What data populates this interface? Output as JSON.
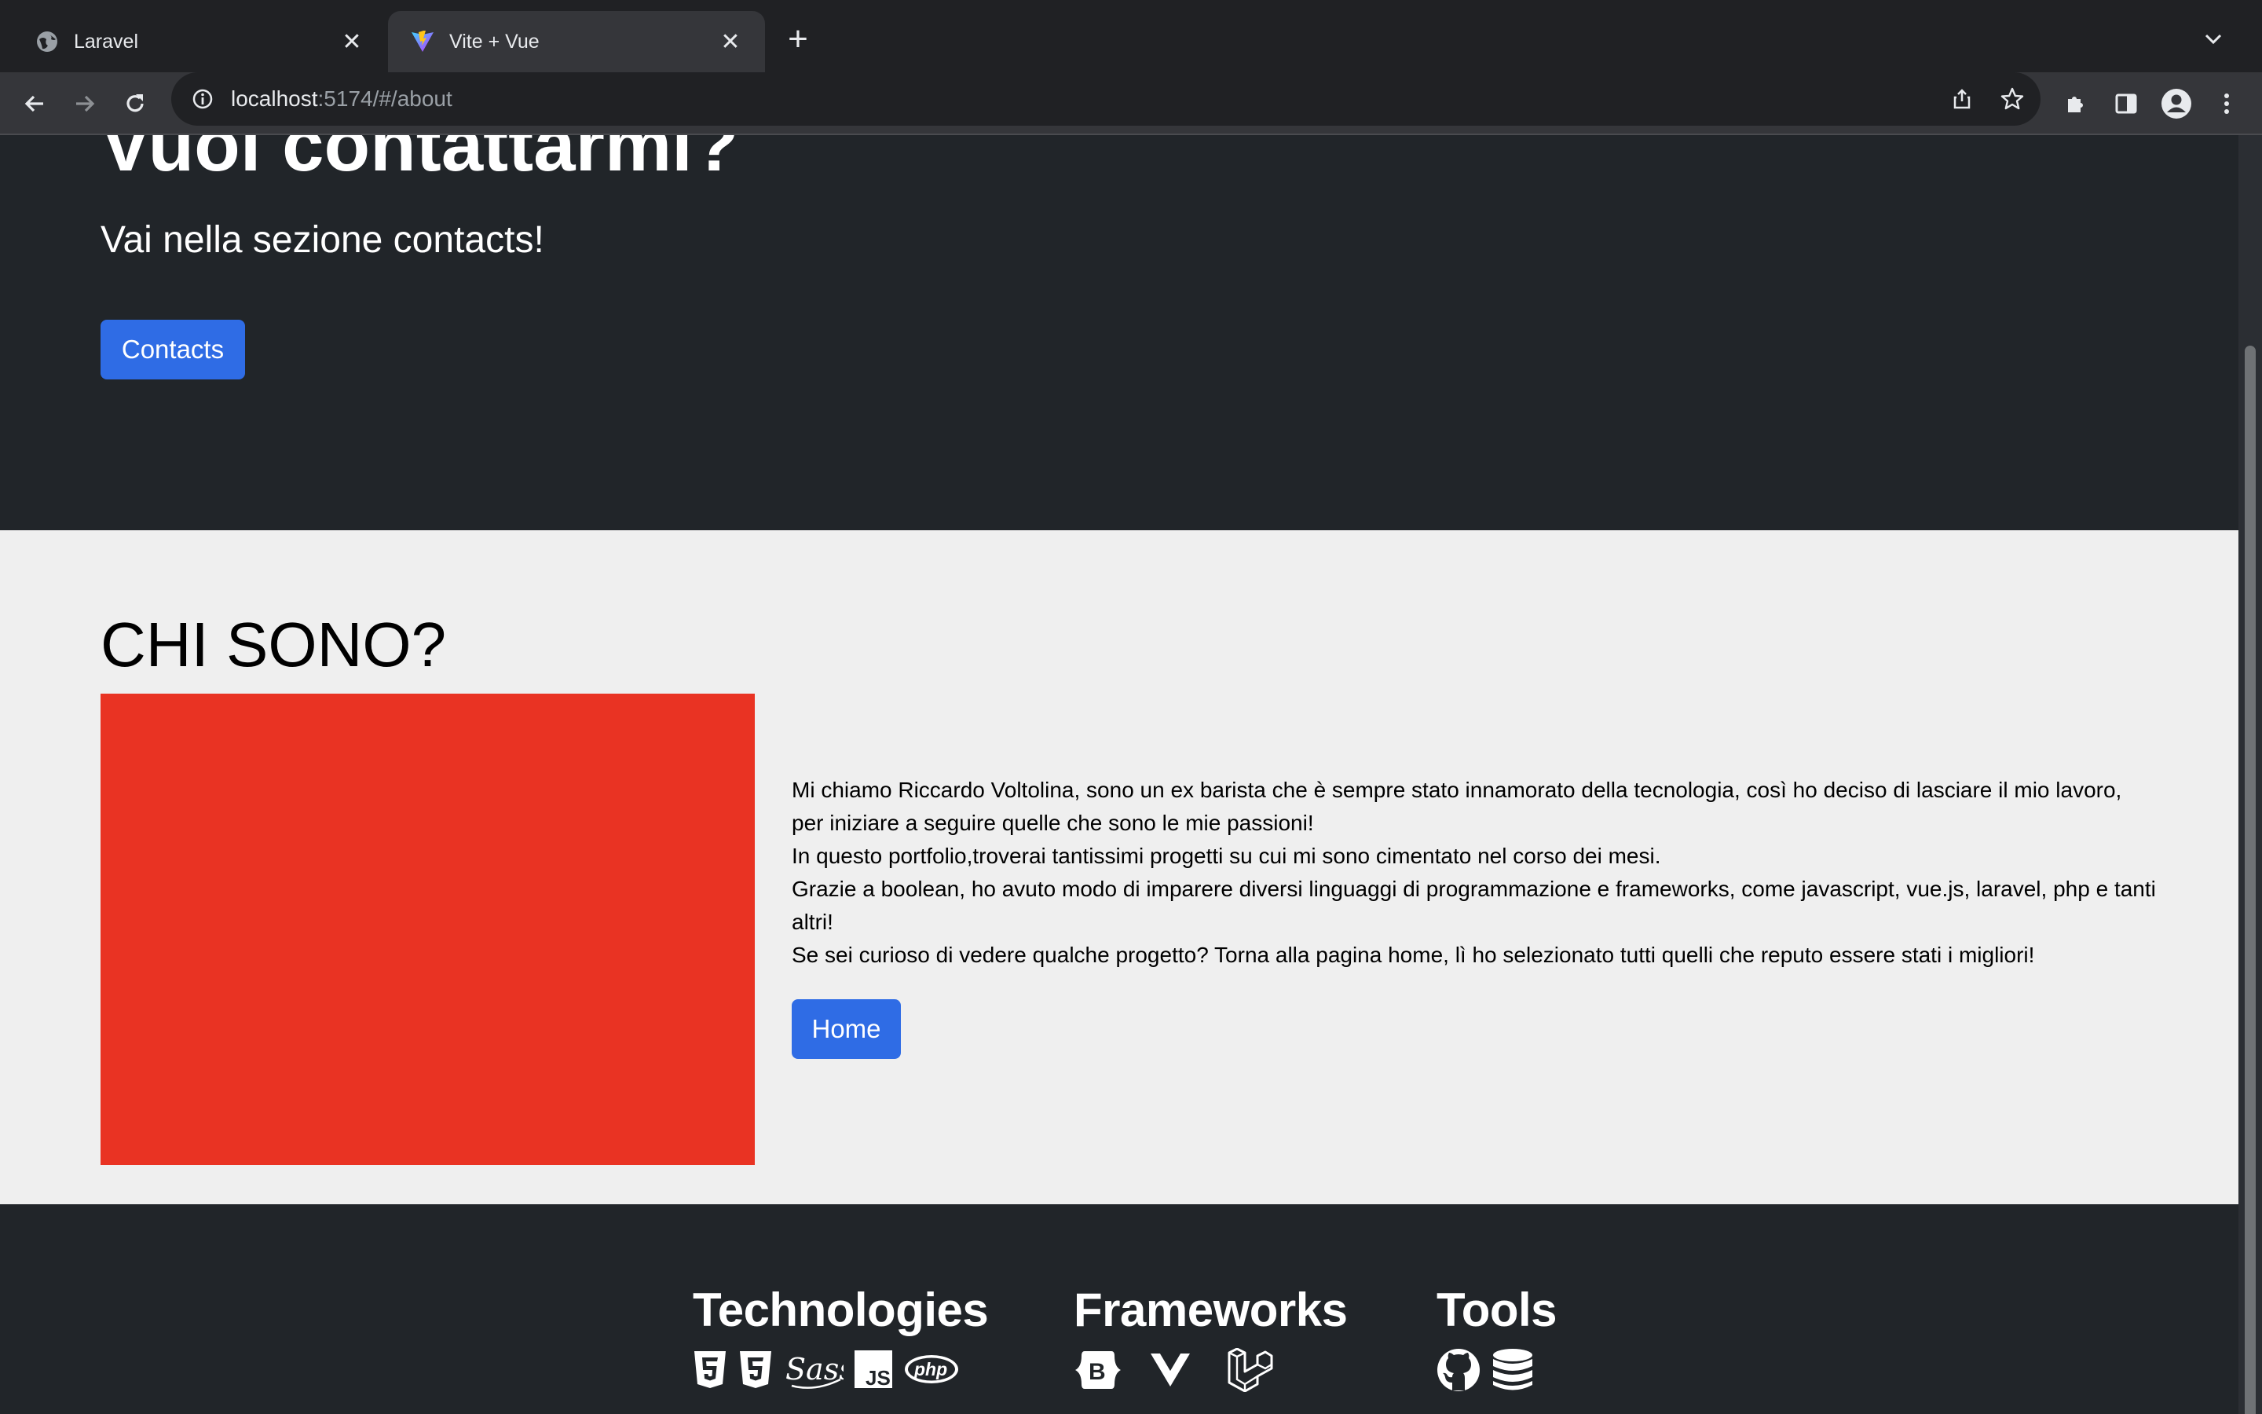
{
  "browser": {
    "tabs": [
      {
        "title": "Laravel",
        "icon": "globe-icon"
      },
      {
        "title": "Vite + Vue",
        "icon": "vite-logo-icon"
      }
    ],
    "url_host": "localhost",
    "url_path": ":5174/#/about"
  },
  "hero": {
    "title": "Vuoi contattarmi?",
    "subtitle": "Vai nella sezione contacts!",
    "button_label": "Contacts"
  },
  "about": {
    "title": "CHI SONO?",
    "lines": [
      "Mi chiamo Riccardo Voltolina, sono un ex barista che è sempre stato innamorato della tecnologia, così ho deciso di lasciare il mio lavoro, per iniziare a seguire quelle che sono le mie passioni!",
      "In questo portfolio,troverai tantissimi progetti su cui mi sono cimentato nel corso dei mesi.",
      "Grazie a boolean, ho avuto modo di imparere diversi linguaggi di programmazione e frameworks, come javascript, vue.js, laravel, php e tanti altri!",
      "Se sei curioso di vedere qualche progetto? Torna alla pagina home, lì ho selezionato tutti quelli che reputo essere stati i migliori!"
    ],
    "button_label": "Home",
    "image_color": "#e93323"
  },
  "footer": {
    "technologies": {
      "title": "Technologies",
      "icons": [
        "html5-icon",
        "css3-icon",
        "sass-icon",
        "javascript-icon",
        "php-icon"
      ]
    },
    "frameworks": {
      "title": "Frameworks",
      "icons": [
        "bootstrap-icon",
        "vue-icon",
        "laravel-icon"
      ]
    },
    "tools": {
      "title": "Tools",
      "icons": [
        "github-icon",
        "database-icon"
      ]
    }
  },
  "colors": {
    "accent": "#2f6ce5",
    "dark_bg": "#212529",
    "light_bg": "#efefef"
  }
}
